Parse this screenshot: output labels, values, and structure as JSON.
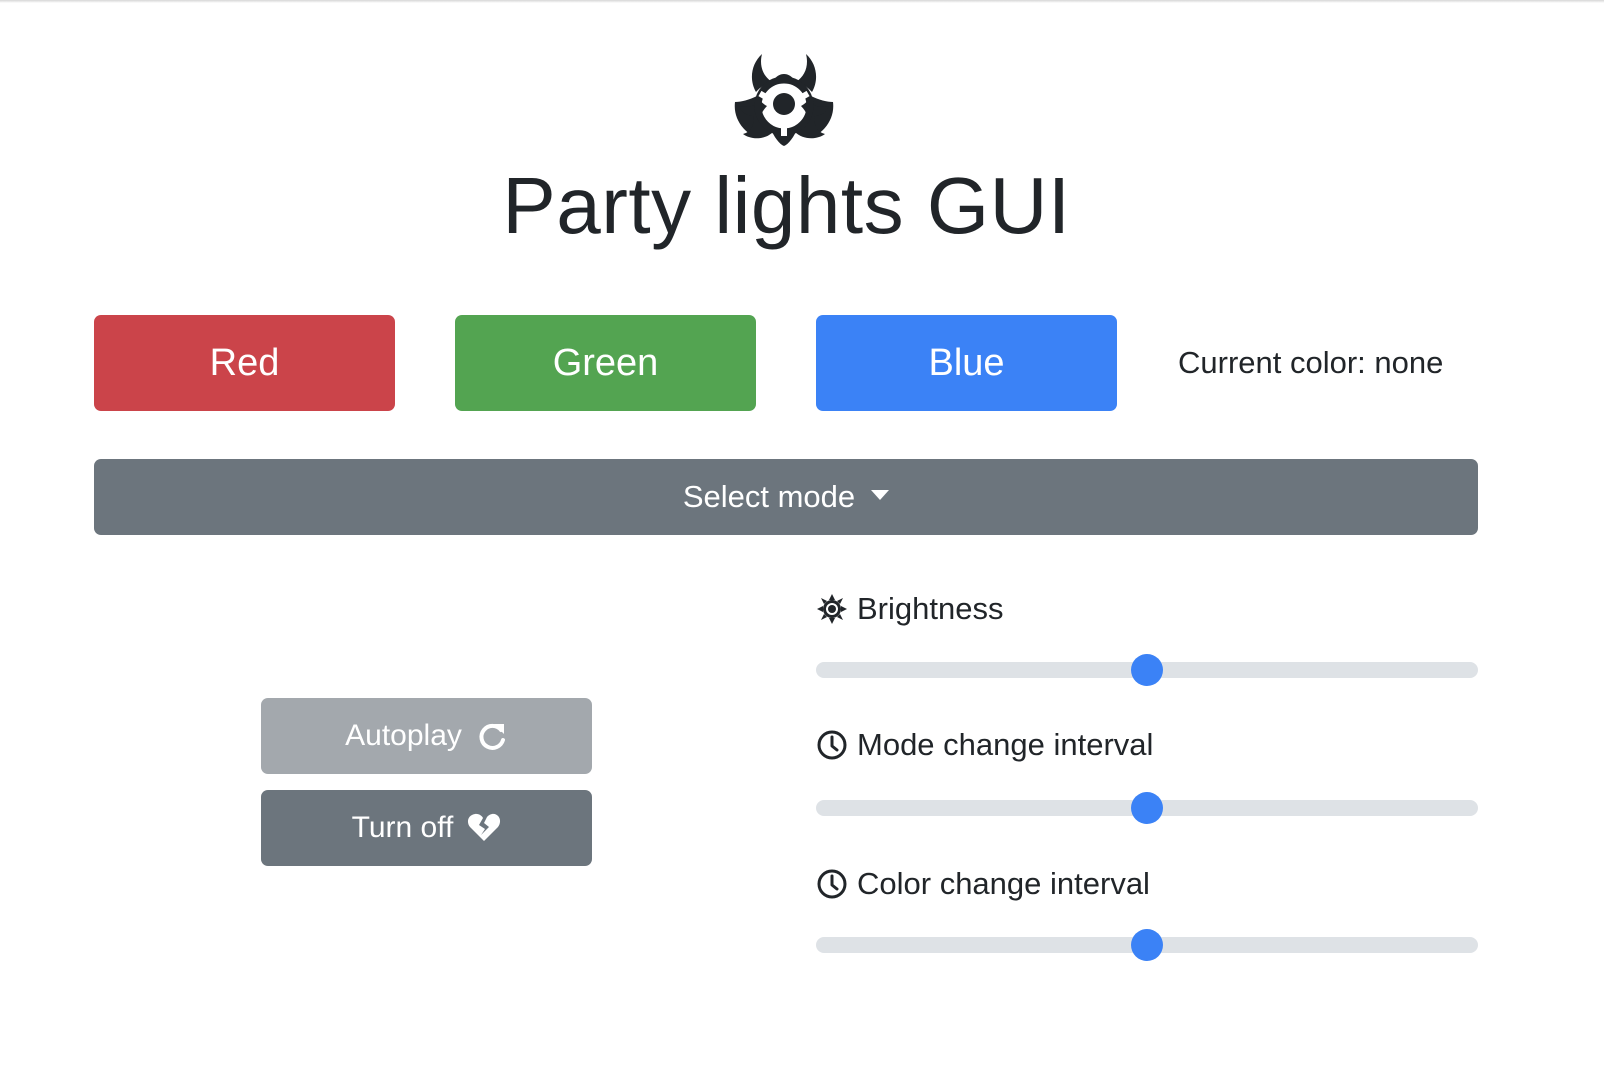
{
  "page": {
    "title": "Party lights GUI",
    "logo_icon": "biohazard-icon"
  },
  "colors": {
    "red_label": "Red",
    "green_label": "Green",
    "blue_label": "Blue",
    "current_color_text": "Current color: none",
    "red_hex": "#cb444a",
    "green_hex": "#53a451",
    "blue_hex": "#3b82f6"
  },
  "mode": {
    "select_label": "Select mode",
    "caret_icon": "caret-down-icon"
  },
  "actions": {
    "autoplay_label": "Autoplay",
    "autoplay_icon": "redo-icon",
    "turnoff_label": "Turn off",
    "turnoff_icon": "heart-broken-icon"
  },
  "sliders": [
    {
      "label": "Brightness",
      "icon": "sun-icon",
      "value": 0.5
    },
    {
      "label": "Mode change interval",
      "icon": "clock-icon",
      "value": 0.5
    },
    {
      "label": "Color change interval",
      "icon": "clock-icon",
      "value": 0.5
    }
  ]
}
